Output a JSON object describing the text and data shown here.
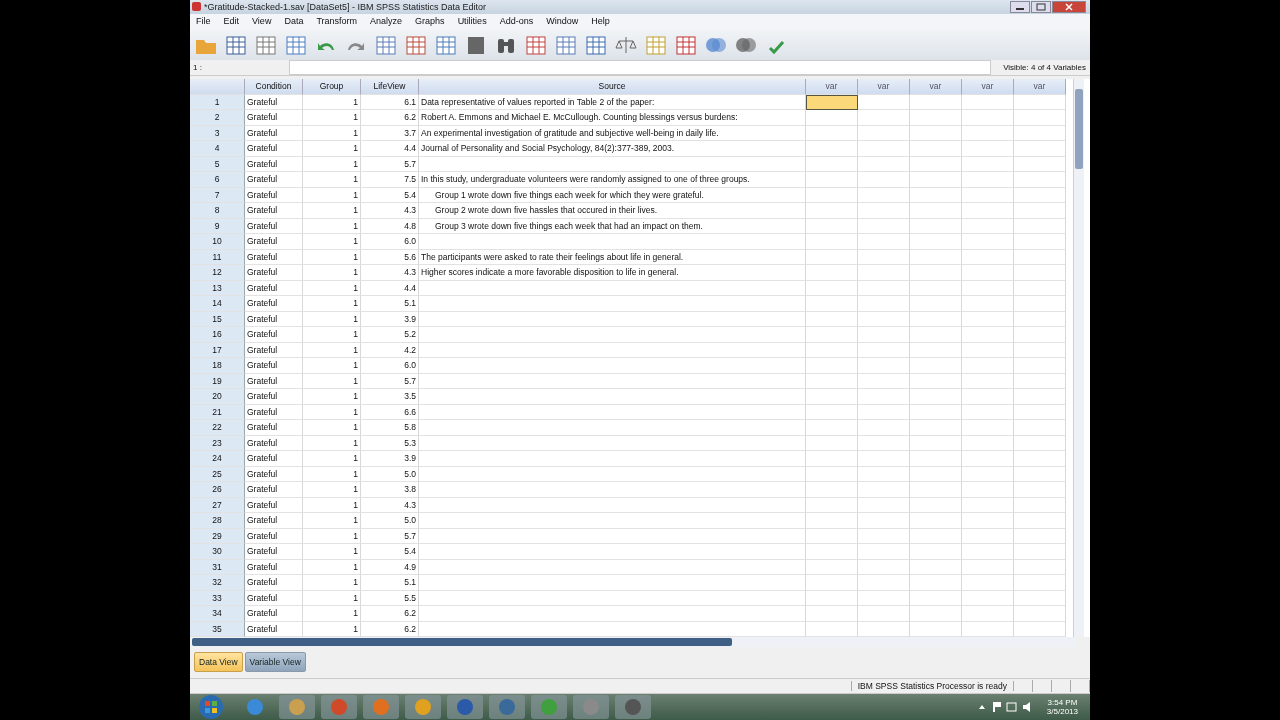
{
  "window": {
    "title": "*Gratitude-Stacked-1.sav [DataSet5] - IBM SPSS Statistics Data Editor"
  },
  "menu": [
    "File",
    "Edit",
    "View",
    "Data",
    "Transform",
    "Analyze",
    "Graphs",
    "Utilities",
    "Add-ons",
    "Window",
    "Help"
  ],
  "cell_editor": {
    "label": "1 :",
    "visible": "Visible: 4 of 4 Variables"
  },
  "table": {
    "columns": [
      "Condition",
      "Group",
      "LifeView",
      "Source",
      "var",
      "var",
      "var",
      "var",
      "var"
    ],
    "rows": [
      {
        "num": "1",
        "condition": "Grateful",
        "group": "1",
        "lifeview": "6.1",
        "source": "Data representative of values reported in Table 2 of the paper:",
        "selected": true
      },
      {
        "num": "2",
        "condition": "Grateful",
        "group": "1",
        "lifeview": "6.2",
        "source": "Robert A. Emmons and Michael E. McCullough. Counting blessings versus burdens:",
        "selected": false
      },
      {
        "num": "3",
        "condition": "Grateful",
        "group": "1",
        "lifeview": "3.7",
        "source": "An experimental investigation of gratitude and subjective well-being in daily life.",
        "selected": false
      },
      {
        "num": "4",
        "condition": "Grateful",
        "group": "1",
        "lifeview": "4.4",
        "source": "Journal of Personality and Social Psychology, 84(2):377-389, 2003.",
        "selected": false
      },
      {
        "num": "5",
        "condition": "Grateful",
        "group": "1",
        "lifeview": "5.7",
        "selected": false
      },
      {
        "num": "6",
        "condition": "Grateful",
        "group": "1",
        "lifeview": "7.5",
        "source": "In this study, undergraduate volunteers were randomly assigned to one of three groups.",
        "selected": false
      },
      {
        "num": "7",
        "condition": "Grateful",
        "group": "1",
        "lifeview": "5.4",
        "source": "Group 1 wrote down five things each week for which they were grateful.",
        "indented": true,
        "selected": false
      },
      {
        "num": "8",
        "condition": "Grateful",
        "group": "1",
        "lifeview": "4.3",
        "source": "Group 2 wrote down five hassles that occured in their lives.",
        "indented": true,
        "selected": false
      },
      {
        "num": "9",
        "condition": "Grateful",
        "group": "1",
        "lifeview": "4.8",
        "source": "Group 3 wrote down five things each week that had an impact on them.",
        "indented": true,
        "selected": false
      },
      {
        "num": "10",
        "condition": "Grateful",
        "group": "1",
        "lifeview": "6.0",
        "selected": false
      },
      {
        "num": "11",
        "condition": "Grateful",
        "group": "1",
        "lifeview": "5.6",
        "source": "The participants were asked to rate their feelings about life in general.",
        "selected": false
      },
      {
        "num": "12",
        "condition": "Grateful",
        "group": "1",
        "lifeview": "4.3",
        "source": "Higher scores indicate a more favorable disposition to life in general.",
        "selected": false
      },
      {
        "num": "13",
        "condition": "Grateful",
        "group": "1",
        "lifeview": "4.4",
        "selected": false
      },
      {
        "num": "14",
        "condition": "Grateful",
        "group": "1",
        "lifeview": "5.1",
        "selected": false
      },
      {
        "num": "15",
        "condition": "Grateful",
        "group": "1",
        "lifeview": "3.9",
        "selected": false
      },
      {
        "num": "16",
        "condition": "Grateful",
        "group": "1",
        "lifeview": "5.2",
        "selected": false
      },
      {
        "num": "17",
        "condition": "Grateful",
        "group": "1",
        "lifeview": "4.2",
        "selected": false
      },
      {
        "num": "18",
        "condition": "Grateful",
        "group": "1",
        "lifeview": "6.0",
        "selected": false
      },
      {
        "num": "19",
        "condition": "Grateful",
        "group": "1",
        "lifeview": "5.7",
        "selected": false
      },
      {
        "num": "20",
        "condition": "Grateful",
        "group": "1",
        "lifeview": "3.5",
        "selected": false
      },
      {
        "num": "21",
        "condition": "Grateful",
        "group": "1",
        "lifeview": "6.6",
        "selected": false
      },
      {
        "num": "22",
        "condition": "Grateful",
        "group": "1",
        "lifeview": "5.8",
        "selected": false
      },
      {
        "num": "23",
        "condition": "Grateful",
        "group": "1",
        "lifeview": "5.3",
        "selected": false
      },
      {
        "num": "24",
        "condition": "Grateful",
        "group": "1",
        "lifeview": "3.9",
        "selected": false
      },
      {
        "num": "25",
        "condition": "Grateful",
        "group": "1",
        "lifeview": "5.0",
        "selected": false
      },
      {
        "num": "26",
        "condition": "Grateful",
        "group": "1",
        "lifeview": "3.8",
        "selected": false
      },
      {
        "num": "27",
        "condition": "Grateful",
        "group": "1",
        "lifeview": "4.3",
        "selected": false
      },
      {
        "num": "28",
        "condition": "Grateful",
        "group": "1",
        "lifeview": "5.0",
        "selected": false
      },
      {
        "num": "29",
        "condition": "Grateful",
        "group": "1",
        "lifeview": "5.7",
        "selected": false
      },
      {
        "num": "30",
        "condition": "Grateful",
        "group": "1",
        "lifeview": "5.4",
        "selected": false
      },
      {
        "num": "31",
        "condition": "Grateful",
        "group": "1",
        "lifeview": "4.9",
        "selected": false
      },
      {
        "num": "32",
        "condition": "Grateful",
        "group": "1",
        "lifeview": "5.1",
        "selected": false
      },
      {
        "num": "33",
        "condition": "Grateful",
        "group": "1",
        "lifeview": "5.5",
        "selected": false
      },
      {
        "num": "34",
        "condition": "Grateful",
        "group": "1",
        "lifeview": "6.2",
        "selected": false
      },
      {
        "num": "35",
        "condition": "Grateful",
        "group": "1",
        "lifeview": "6.2",
        "selected": false
      }
    ]
  },
  "view_tabs": [
    {
      "label": "Data View",
      "selected": true
    },
    {
      "label": "Variable View",
      "selected": false
    }
  ],
  "status_bar": {
    "text": "IBM SPSS Statistics Processor is ready"
  },
  "taskbar": {
    "time": "3:54 PM",
    "date": "3/5/2013"
  }
}
